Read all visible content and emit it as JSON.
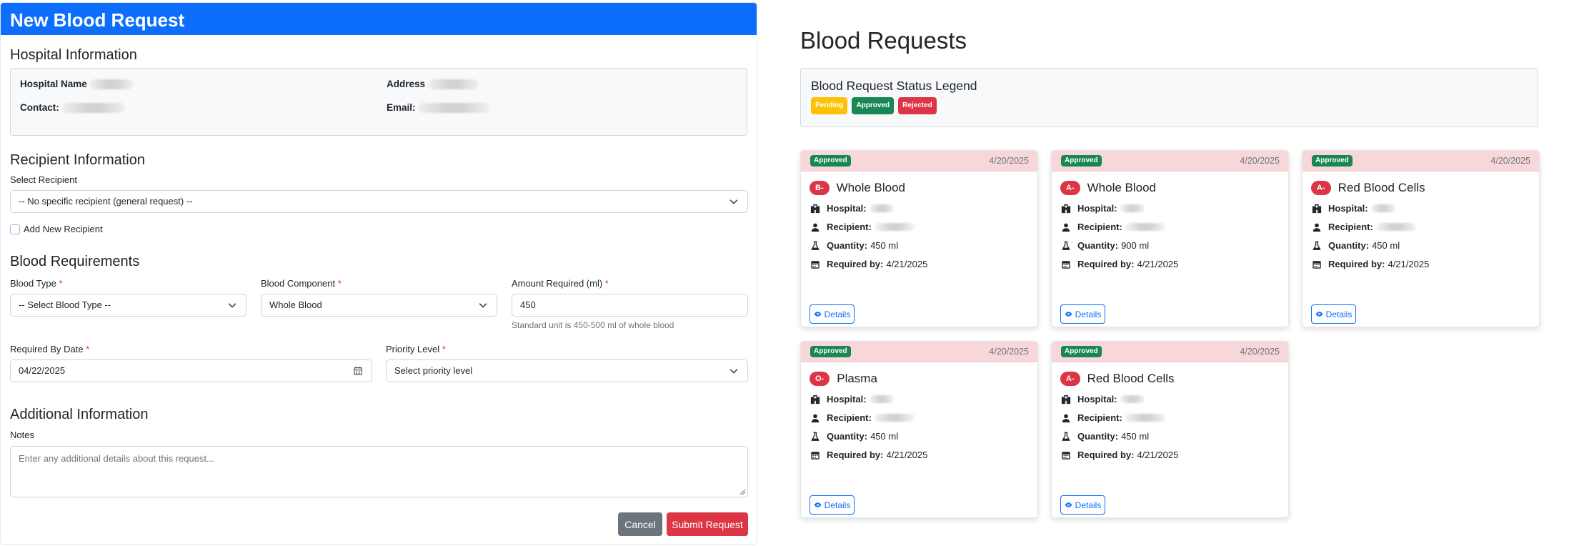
{
  "form": {
    "header_title": "New Blood Request",
    "hospital_section_title": "Hospital Information",
    "hospital": {
      "name_label": "Hospital Name",
      "address_label": "Address",
      "contact_label": "Contact:",
      "email_label": "Email:"
    },
    "recipient_section_title": "Recipient Information",
    "select_recipient_label": "Select Recipient",
    "select_recipient_value": "-- No specific recipient (general request) --",
    "add_new_recipient_label": "Add New Recipient",
    "requirements_section_title": "Blood Requirements",
    "blood_type_label": "Blood Type",
    "blood_type_value": "-- Select Blood Type --",
    "component_label": "Blood Component",
    "component_value": "Whole Blood",
    "amount_label": "Amount Required (ml)",
    "amount_value": "450",
    "amount_help": "Standard unit is 450-500 ml of whole blood",
    "required_by_label": "Required By Date",
    "required_by_value": "04/22/2025",
    "priority_label": "Priority Level",
    "priority_value": "Select priority level",
    "required_marker": "*",
    "additional_section_title": "Additional Information",
    "notes_label": "Notes",
    "notes_placeholder": "Enter any additional details about this request...",
    "cancel_label": "Cancel",
    "submit_label": "Submit Request"
  },
  "list": {
    "title": "Blood Requests",
    "legend_title": "Blood Request Status Legend",
    "legend": {
      "pending": "Pending",
      "approved": "Approved",
      "rejected": "Rejected"
    },
    "labels": {
      "hospital": "Hospital:",
      "recipient": "Recipient:",
      "quantity": "Quantity:",
      "required_by": "Required by:",
      "details": "Details"
    },
    "requests": [
      {
        "status": "Approved",
        "date": "4/20/2025",
        "blood_type": "B-",
        "component": "Whole Blood",
        "quantity": "450 ml",
        "required_by": "4/21/2025"
      },
      {
        "status": "Approved",
        "date": "4/20/2025",
        "blood_type": "A-",
        "component": "Whole Blood",
        "quantity": "900 ml",
        "required_by": "4/21/2025"
      },
      {
        "status": "Approved",
        "date": "4/20/2025",
        "blood_type": "A-",
        "component": "Red Blood Cells",
        "quantity": "450 ml",
        "required_by": "4/21/2025"
      },
      {
        "status": "Approved",
        "date": "4/20/2025",
        "blood_type": "O-",
        "component": "Plasma",
        "quantity": "450 ml",
        "required_by": "4/21/2025"
      },
      {
        "status": "Approved",
        "date": "4/20/2025",
        "blood_type": "A-",
        "component": "Red Blood Cells",
        "quantity": "450 ml",
        "required_by": "4/21/2025"
      }
    ]
  },
  "colors": {
    "primary": "#0d6efd",
    "danger": "#dc3545",
    "success": "#198754",
    "warning": "#ffc107",
    "secondary": "#6c757d",
    "card_header": "#f8d7da"
  }
}
